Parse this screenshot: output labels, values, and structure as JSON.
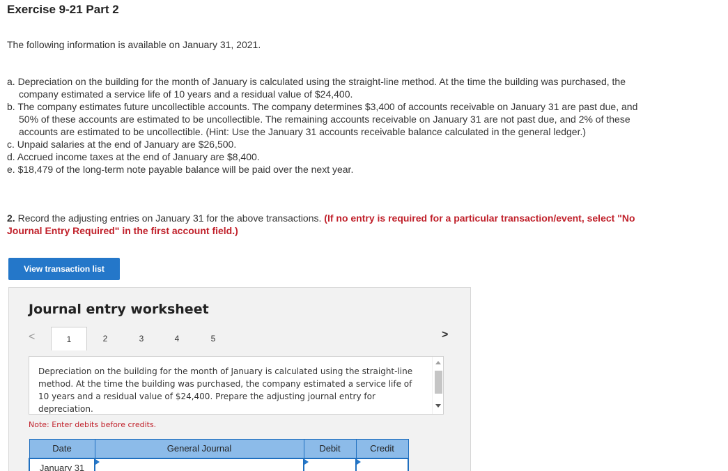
{
  "header": {
    "title": "Exercise 9-21 Part 2"
  },
  "intro": "The following information is available on January 31, 2021.",
  "items": [
    "a. Depreciation on the building for the month of January is calculated using the straight-line method. At the time the building was purchased, the company estimated a service life of 10 years and a residual value of $24,400.",
    "b. The company estimates future uncollectible accounts. The company determines $3,400 of accounts receivable on January 31 are past due, and 50% of these accounts are estimated to be uncollectible. The remaining accounts receivable on January 31 are not past due, and 2% of these accounts are estimated to be uncollectible. (Hint: Use the January 31 accounts receivable balance calculated in the general ledger.)",
    "c. Unpaid salaries at the end of January are $26,500.",
    "d. Accrued income taxes at the end of January are $8,400.",
    "e. $18,479 of the long-term note payable balance will be paid over the next year."
  ],
  "instruction": {
    "number": "2.",
    "text": " Record the adjusting entries on January 31 for the above transactions. ",
    "emphasis": "(If no entry is required for a particular transaction/event, select \"No Journal Entry Required\" in the first account field.)"
  },
  "view_button_label": "View transaction list",
  "worksheet": {
    "title": "Journal entry worksheet",
    "prev_glyph": "<",
    "next_glyph": ">",
    "tabs": [
      "1",
      "2",
      "3",
      "4",
      "5"
    ],
    "description": "Depreciation on the building for the month of January is calculated using the straight-line method. At the time the building was purchased, the company estimated a service life of 10 years and a residual value of $24,400. Prepare the adjusting journal entry for depreciation.",
    "note": "Note: Enter debits before credits.",
    "columns": {
      "date": "Date",
      "journal": "General Journal",
      "debit": "Debit",
      "credit": "Credit"
    },
    "rows": [
      {
        "date": "January 31"
      }
    ]
  },
  "colors": {
    "accent": "#2477c9",
    "header_fill": "#8cbbe9",
    "alert": "#c0202a"
  }
}
